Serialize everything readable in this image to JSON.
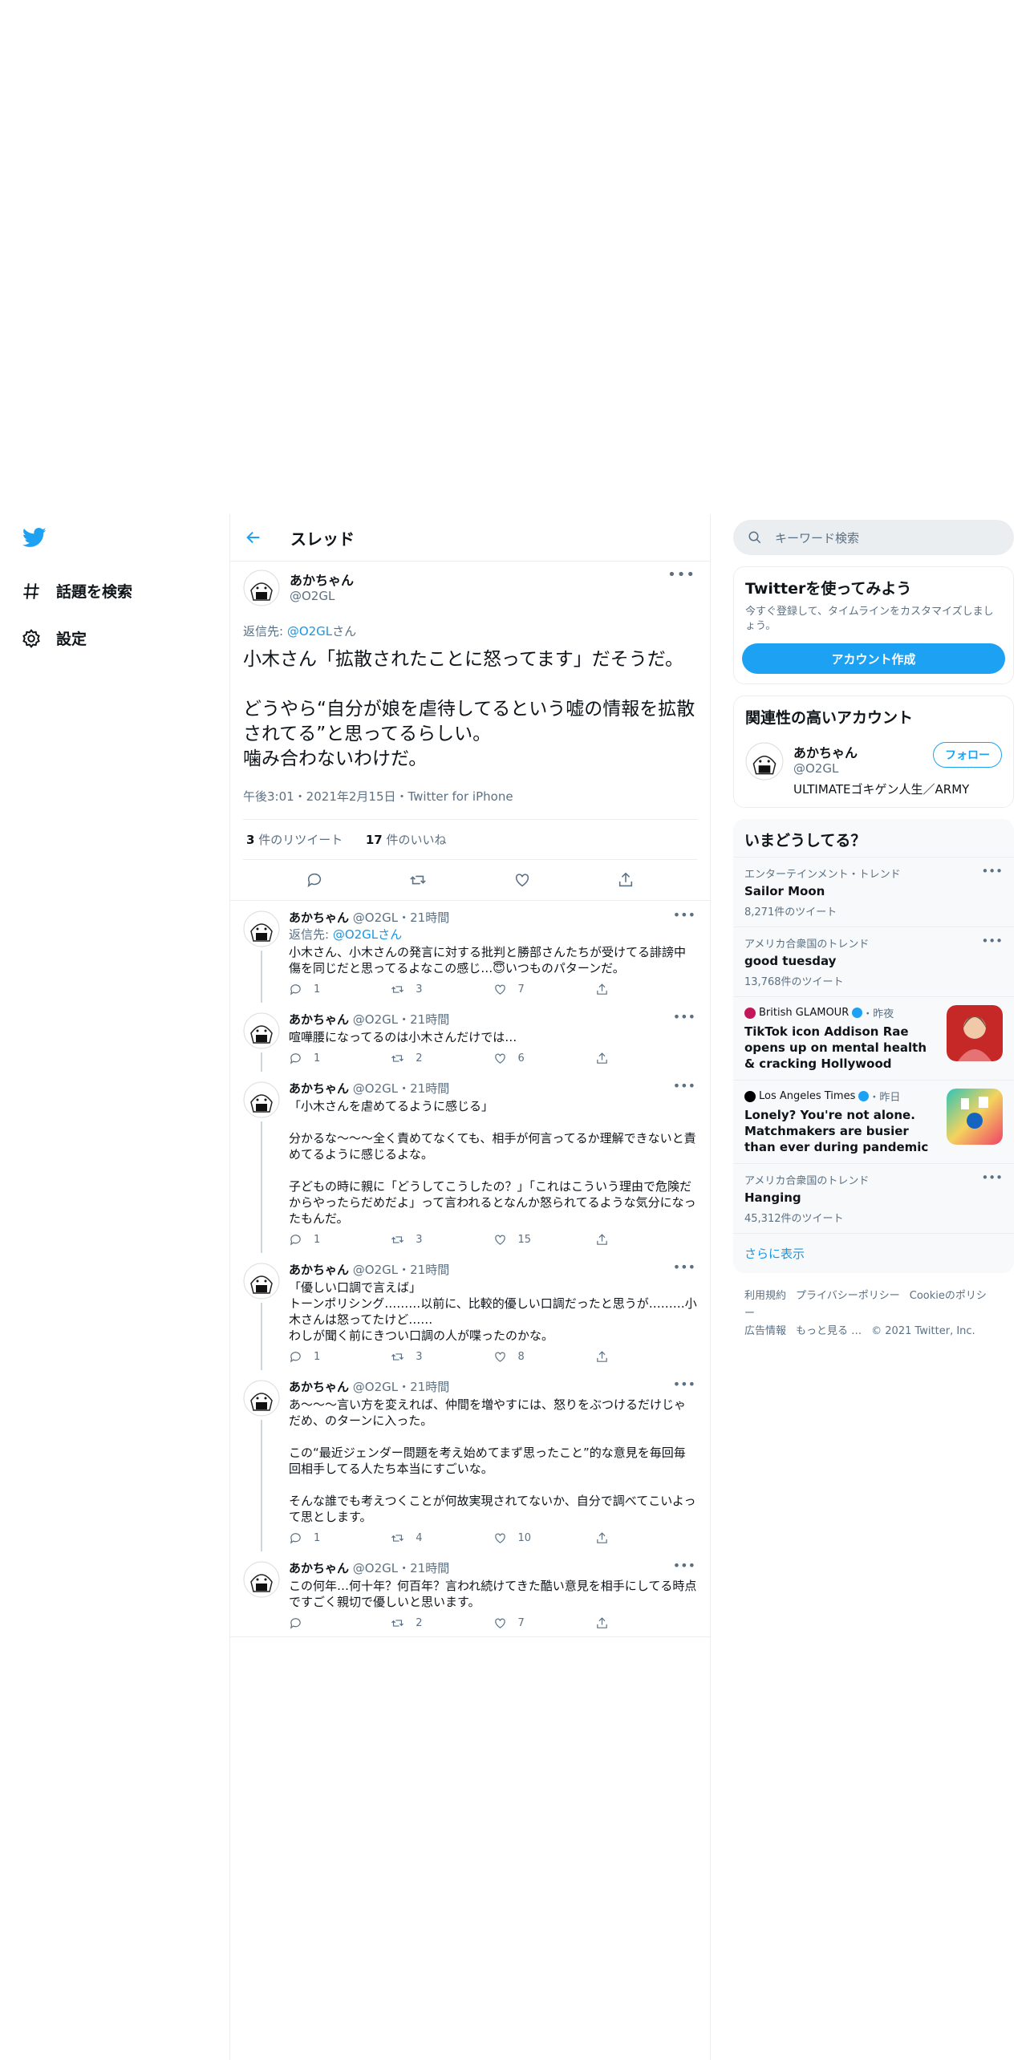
{
  "nav": {
    "explore": "話題を検索",
    "settings": "設定"
  },
  "header": {
    "title": "スレッド"
  },
  "main_tweet": {
    "name": "あかちゃん",
    "handle": "@O2GL",
    "reply_prefix": "返信先: ",
    "reply_to": "@O2GL",
    "reply_suffix": "さん",
    "text": "小木さん「拡散されたことに怒ってます」だそうだ。\n\nどうやら“自分が娘を虐待してるという嘘の情報を拡散されてる”と思ってるらしい。\n噛み合わないわけだ。",
    "meta": "午後3:01・2021年2月15日・Twitter for iPhone",
    "retweets": "3",
    "retweets_label": " 件のリツイート",
    "likes": "17",
    "likes_label": " 件のいいね"
  },
  "replies": [
    {
      "name": "あかちゃん",
      "meta": "@O2GL・21時間",
      "reply_prefix": "返信先: ",
      "reply_to": "@O2GLさん",
      "text": "小木さん、小木さんの発言に対する批判と勝部さんたちが受けてる誹謗中傷を同じだと思ってるよなこの感じ…😇いつものパターンだ。",
      "replies": "1",
      "retweets": "3",
      "likes": "7"
    },
    {
      "name": "あかちゃん",
      "meta": "@O2GL・21時間",
      "text": "喧嘩腰になってるのは小木さんだけでは…",
      "replies": "1",
      "retweets": "2",
      "likes": "6"
    },
    {
      "name": "あかちゃん",
      "meta": "@O2GL・21時間",
      "text": "「小木さんを虐めてるように感じる」\n\n分かるな〜〜〜全く責めてなくても、相手が何言ってるか理解できないと責めてるように感じるよな。\n\n子どもの時に親に「どうしてこうしたの？」「これはこういう理由で危険だからやったらだめだよ」って言われるとなんか怒られてるような気分になったもんだ。",
      "replies": "1",
      "retweets": "3",
      "likes": "15"
    },
    {
      "name": "あかちゃん",
      "meta": "@O2GL・21時間",
      "text": "「優しい口調で言えば」\nトーンポリシング………以前に、比較的優しい口調だったと思うが………小木さんは怒ってたけど……\nわしが聞く前にきつい口調の人が喋ったのかな。",
      "replies": "1",
      "retweets": "3",
      "likes": "8"
    },
    {
      "name": "あかちゃん",
      "meta": "@O2GL・21時間",
      "text": "あ〜〜〜言い方を変えれば、仲間を増やすには、怒りをぶつけるだけじゃだめ、のターンに入った。\n\nこの“最近ジェンダー問題を考え始めてまず思ったこと”的な意見を毎回毎回相手してる人たち本当にすごいな。\n\nそんな誰でも考えつくことが何故実現されてないか、自分で調べてこいよって思とします。",
      "replies": "1",
      "retweets": "4",
      "likes": "10"
    },
    {
      "name": "あかちゃん",
      "meta": "@O2GL・21時間",
      "text": "この何年…何十年？何百年？言われ続けてきた酷い意見を相手にしてる時点ですごく親切で優しいと思います。",
      "replies": "",
      "retweets": "2",
      "likes": "7"
    }
  ],
  "search": {
    "placeholder": "キーワード検索"
  },
  "signup": {
    "title": "Twitterを使ってみよう",
    "sub": "今すぐ登録して、タイムラインをカスタマイズしましょう。",
    "button": "アカウント作成"
  },
  "related": {
    "title": "関連性の高いアカウント",
    "name": "あかちゃん",
    "handle": "@O2GL",
    "bio": "ULTIMATEゴキゲン人生／ARMY",
    "follow": "フォロー"
  },
  "trends": {
    "title": "いまどうしてる？",
    "items": [
      {
        "ctx": "エンターテインメント・トレンド",
        "title": "Sailor Moon",
        "count": "8,271件のツイート"
      },
      {
        "ctx": "アメリカ合衆国のトレンド",
        "title": "good tuesday",
        "count": "13,768件のツイート"
      }
    ],
    "news": [
      {
        "source": "British GLAMOUR",
        "time": "・昨夜",
        "title": "TikTok icon Addison Rae opens up on mental health & cracking Hollywood"
      },
      {
        "source": "Los Angeles Times",
        "time": "・昨日",
        "title": "Lonely? You're not alone. Matchmakers are busier than ever during pandemic"
      }
    ],
    "last": {
      "ctx": "アメリカ合衆国のトレンド",
      "title": "Hanging",
      "count": "45,312件のツイート"
    },
    "more": "さらに表示"
  },
  "footer": {
    "terms": "利用規約",
    "privacy": "プライバシーポリシー",
    "cookie": "Cookieのポリシー",
    "ads": "広告情報",
    "more": "もっと見る …",
    "copy": "© 2021 Twitter, Inc."
  },
  "colors": {
    "accent": "#1da1f2",
    "text": "#0f1419",
    "muted": "#5b7083",
    "border": "#ebeef0"
  }
}
